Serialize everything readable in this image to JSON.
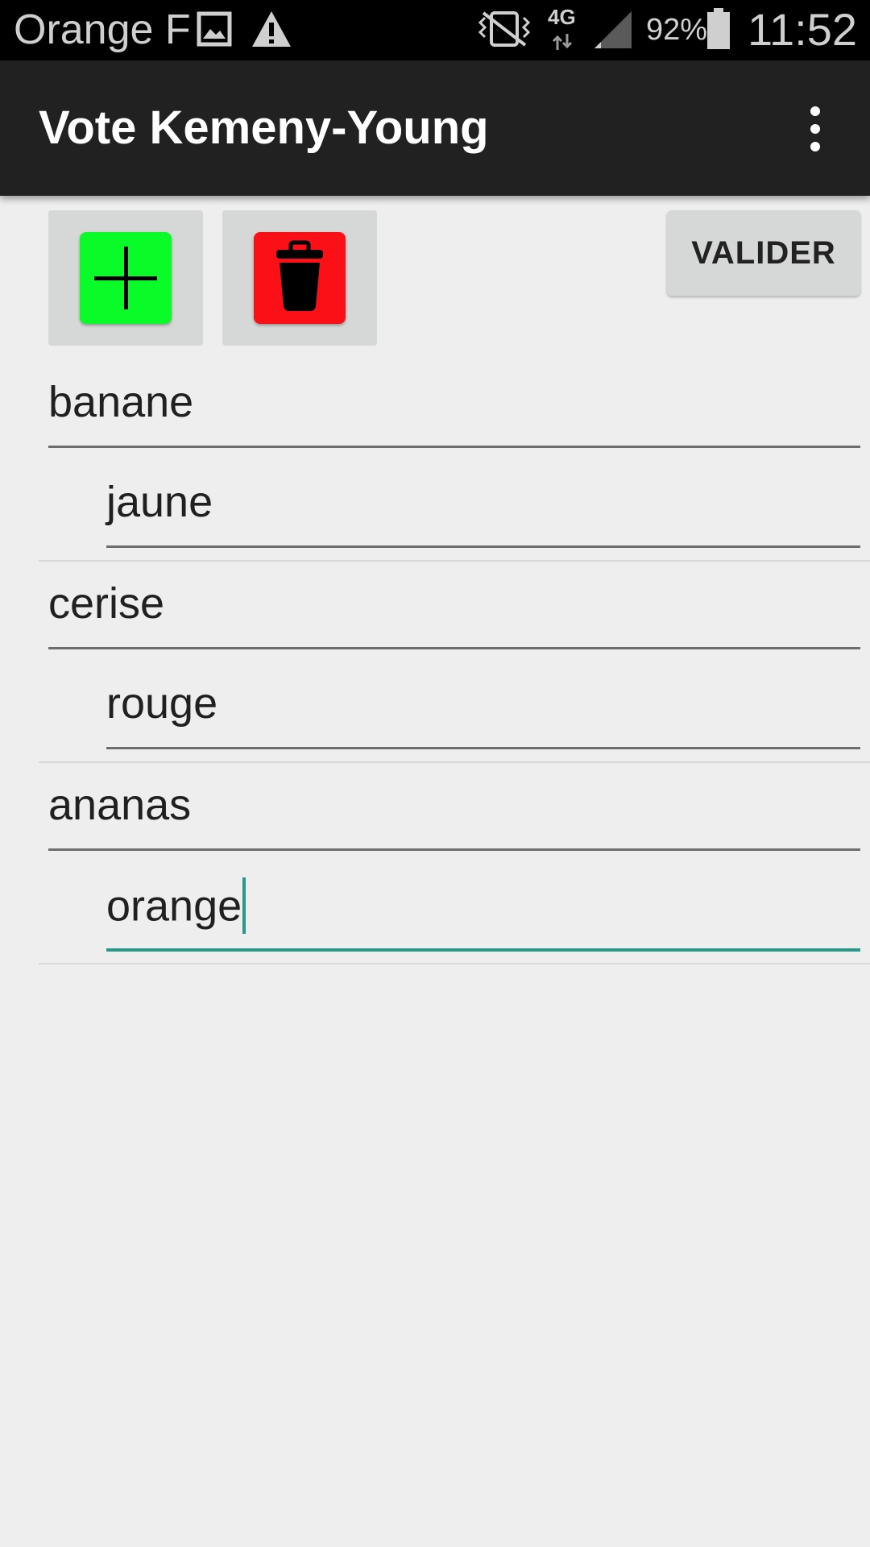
{
  "status_bar": {
    "carrier": "Orange F",
    "network": "4G",
    "battery_percent": "92%",
    "clock": "11:52"
  },
  "app_bar": {
    "title": "Vote Kemeny-Young",
    "overflow_icon": "more-vert-icon"
  },
  "toolbar": {
    "add_icon": "plus-icon",
    "add_color": "#0afc28",
    "delete_icon": "trash-icon",
    "delete_color": "#fb1017",
    "validate_label": "VALIDER"
  },
  "candidates": [
    {
      "name": "banane",
      "description": "jaune"
    },
    {
      "name": "cerise",
      "description": "rouge"
    },
    {
      "name": "ananas",
      "description": "orange"
    }
  ],
  "colors": {
    "accent": "#26998b",
    "app_bar": "#212121",
    "background": "#eeeeee"
  }
}
